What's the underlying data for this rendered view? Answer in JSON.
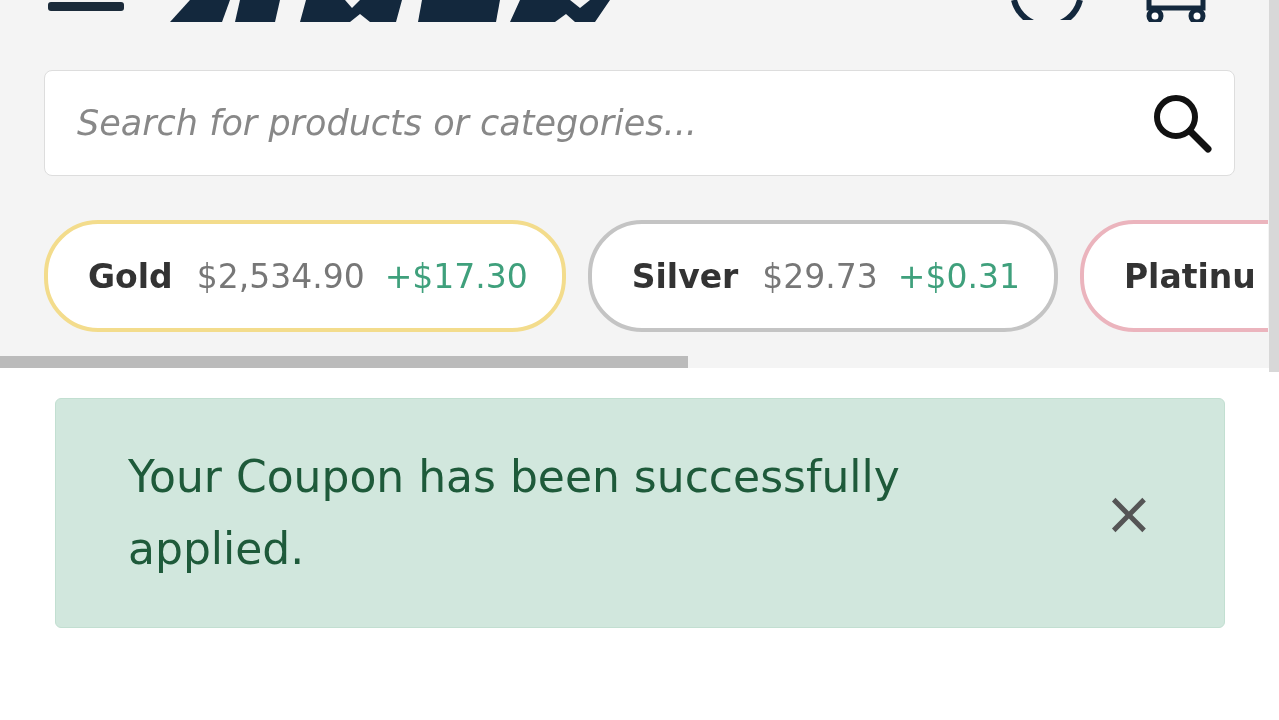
{
  "search": {
    "placeholder": "Search for products or categories..."
  },
  "tickers": [
    {
      "name": "Gold",
      "price": "$2,534.90",
      "change": "+$17.30",
      "color": "#f3dc8c"
    },
    {
      "name": "Silver",
      "price": "$29.73",
      "change": "+$0.31",
      "color": "#c4c4c4"
    },
    {
      "name": "Platinu",
      "color": "#ebb4bd"
    }
  ],
  "alert": {
    "message": "Your Coupon has been successfully applied.",
    "close": "×"
  }
}
